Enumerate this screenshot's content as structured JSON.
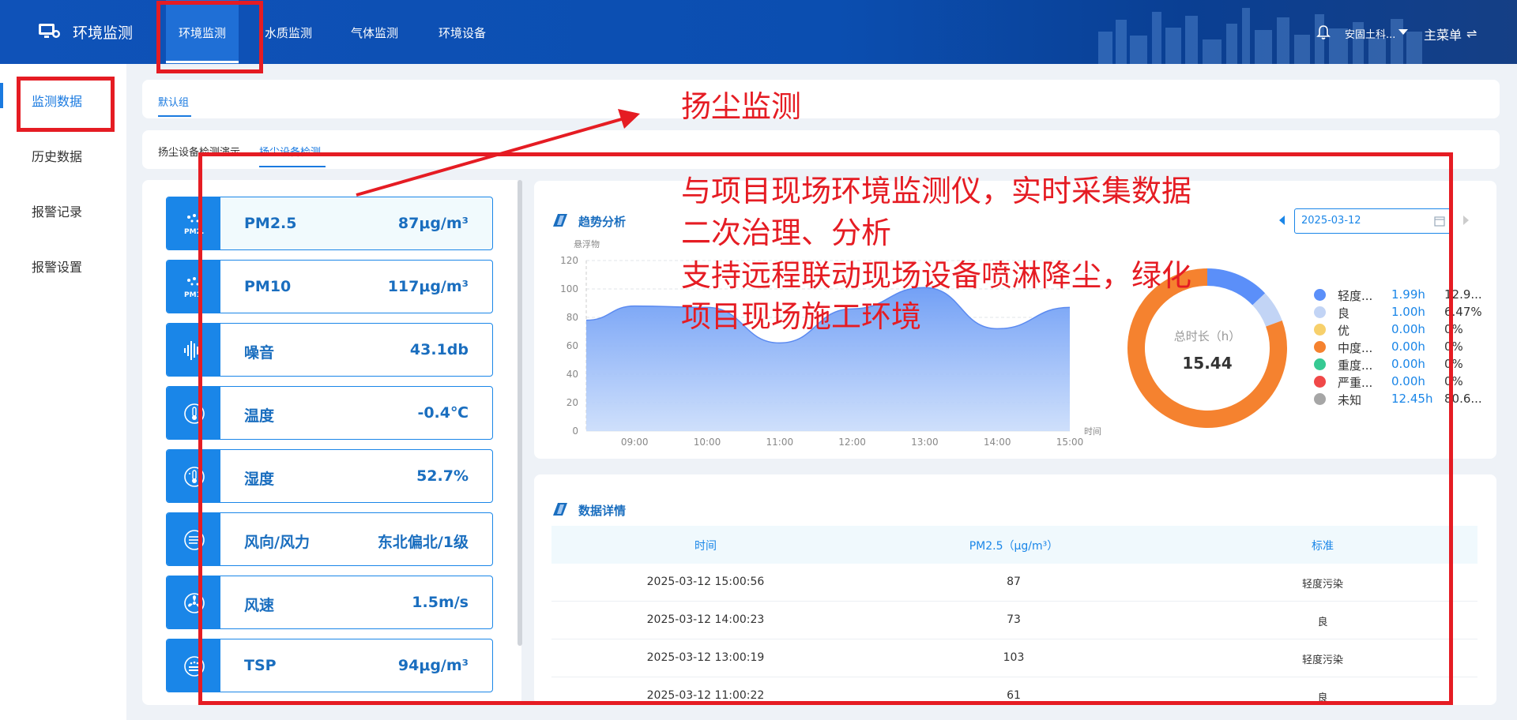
{
  "header": {
    "app_title": "环境监测",
    "nav": [
      "环境监测",
      "水质监测",
      "气体监测",
      "环境设备"
    ],
    "user": "安固土科...",
    "main_menu": "主菜单",
    "main_menu_icon": "⇌"
  },
  "sidebar": {
    "items": [
      "监测数据",
      "历史数据",
      "报警记录",
      "报警设置"
    ]
  },
  "group_tab": "默认组",
  "device_tabs": [
    "扬尘设备检测演示",
    "扬尘设备检测"
  ],
  "metrics": [
    {
      "name": "PM2.5",
      "value": "87μg/m³",
      "icon": "pm25-icon"
    },
    {
      "name": "PM10",
      "value": "117μg/m³",
      "icon": "pm10-icon"
    },
    {
      "name": "噪音",
      "value": "43.1db",
      "icon": "noise-icon"
    },
    {
      "name": "温度",
      "value": "-0.4℃",
      "icon": "temperature-icon"
    },
    {
      "name": "湿度",
      "value": "52.7%",
      "icon": "humidity-icon"
    },
    {
      "name": "风向/风力",
      "value": "东北偏北/1级",
      "icon": "wind-direction-icon"
    },
    {
      "name": "风速",
      "value": "1.5m/s",
      "icon": "wind-speed-icon"
    },
    {
      "name": "TSP",
      "value": "94μg/m³",
      "icon": "tsp-icon"
    }
  ],
  "trend": {
    "title": "趋势分析",
    "date": "2025-03-12"
  },
  "chart_data": {
    "type": "area",
    "ylabel": "悬浮物",
    "xlabel": "时间",
    "ylim": [
      0,
      120
    ],
    "yticks": [
      "0",
      "20",
      "40",
      "60",
      "80",
      "100",
      "120"
    ],
    "xticks": [
      "09:00",
      "10:00",
      "11:00",
      "12:00",
      "13:00",
      "14:00",
      "15:00"
    ],
    "x": [
      "08:20",
      "09:00",
      "10:00",
      "11:00",
      "12:00",
      "13:00",
      "14:00",
      "15:00"
    ],
    "values": [
      78,
      88,
      87,
      62,
      86,
      101,
      72,
      87
    ],
    "grid": true,
    "color": "#6b9bf5"
  },
  "donut": {
    "label": "总时长（h）",
    "total": "15.44",
    "segments": [
      {
        "name": "轻度...",
        "time": "1.99h",
        "pct": "12.9...",
        "color": "#5b8ff9",
        "value": 1.99
      },
      {
        "name": "良",
        "time": "1.00h",
        "pct": "6.47%",
        "color": "#c2d4f5",
        "value": 1.0
      },
      {
        "name": "优",
        "time": "0.00h",
        "pct": "0%",
        "color": "#f7d06b",
        "value": 0
      },
      {
        "name": "中度...",
        "time": "0.00h",
        "pct": "0%",
        "color": "#f5822f",
        "value": 0
      },
      {
        "name": "重度...",
        "time": "0.00h",
        "pct": "0%",
        "color": "#36c993",
        "value": 0
      },
      {
        "name": "严重...",
        "time": "0.00h",
        "pct": "0%",
        "color": "#f04848",
        "value": 0
      },
      {
        "name": "未知",
        "time": "12.45h",
        "pct": "80.6...",
        "color": "#a6a6a6",
        "value": 12.45
      }
    ]
  },
  "details": {
    "title": "数据详情",
    "headers": [
      "时间",
      "PM2.5（μg/m³）",
      "标准"
    ],
    "rows": [
      [
        "2025-03-12 15:00:56",
        "87",
        "轻度污染"
      ],
      [
        "2025-03-12 14:00:23",
        "73",
        "良"
      ],
      [
        "2025-03-12 13:00:19",
        "103",
        "轻度污染"
      ],
      [
        "2025-03-12 11:00:22",
        "61",
        "良"
      ]
    ]
  },
  "annotations": {
    "heading": "扬尘监测",
    "lines": [
      "与项目现场环境监测仪，实时采集数据",
      "二次治理、分析",
      "支持远程联动现场设备喷淋降尘，绿化",
      "项目现场施工环境"
    ]
  },
  "colors": {
    "header": "#0f52b8",
    "accent": "#1a86e8",
    "annotation": "#e51c23",
    "donut_orange": "#f5822f"
  }
}
